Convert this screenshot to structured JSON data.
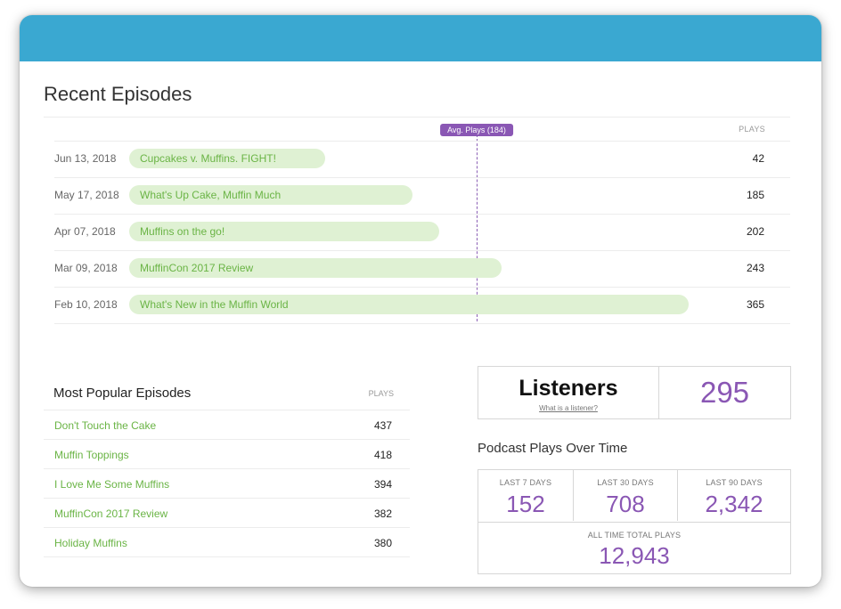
{
  "recent": {
    "title": "Recent Episodes",
    "plays_header": "PLAYS",
    "avg_label": "Avg. Plays (184)",
    "avg_value": 184,
    "scale_max": 365,
    "episodes": [
      {
        "date": "Jun 13, 2018",
        "title": "Cupcakes v. Muffins. FIGHT!",
        "plays": 42
      },
      {
        "date": "May 17, 2018",
        "title": "What's Up Cake, Muffin Much",
        "plays": 185
      },
      {
        "date": "Apr 07, 2018",
        "title": "Muffins on the go!",
        "plays": 202
      },
      {
        "date": "Mar 09, 2018",
        "title": "MuffinCon 2017 Review",
        "plays": 243
      },
      {
        "date": "Feb 10, 2018",
        "title": "What's New in the Muffin World",
        "plays": 365
      }
    ]
  },
  "popular": {
    "title": "Most Popular Episodes",
    "plays_header": "PLAYS",
    "episodes": [
      {
        "title": "Don't Touch the Cake",
        "plays": "437"
      },
      {
        "title": "Muffin Toppings",
        "plays": "418"
      },
      {
        "title": "I Love Me Some Muffins",
        "plays": "394"
      },
      {
        "title": "MuffinCon 2017 Review",
        "plays": "382"
      },
      {
        "title": "Holiday Muffins",
        "plays": "380"
      }
    ]
  },
  "listeners": {
    "label": "Listeners",
    "link": "What is a listener?",
    "count": "295"
  },
  "plays_over_time": {
    "title": "Podcast Plays Over Time",
    "periods": [
      {
        "label": "LAST 7 DAYS",
        "value": "152"
      },
      {
        "label": "LAST 30 DAYS",
        "value": "708"
      },
      {
        "label": "LAST 90 DAYS",
        "value": "2,342"
      }
    ],
    "total_label": "ALL TIME TOTAL PLAYS",
    "total_value": "12,943"
  },
  "colors": {
    "header": "#3aa8d1",
    "accent_purple": "#8a57b4",
    "bar_fill": "#dff1d3",
    "link_green": "#6ab445"
  }
}
